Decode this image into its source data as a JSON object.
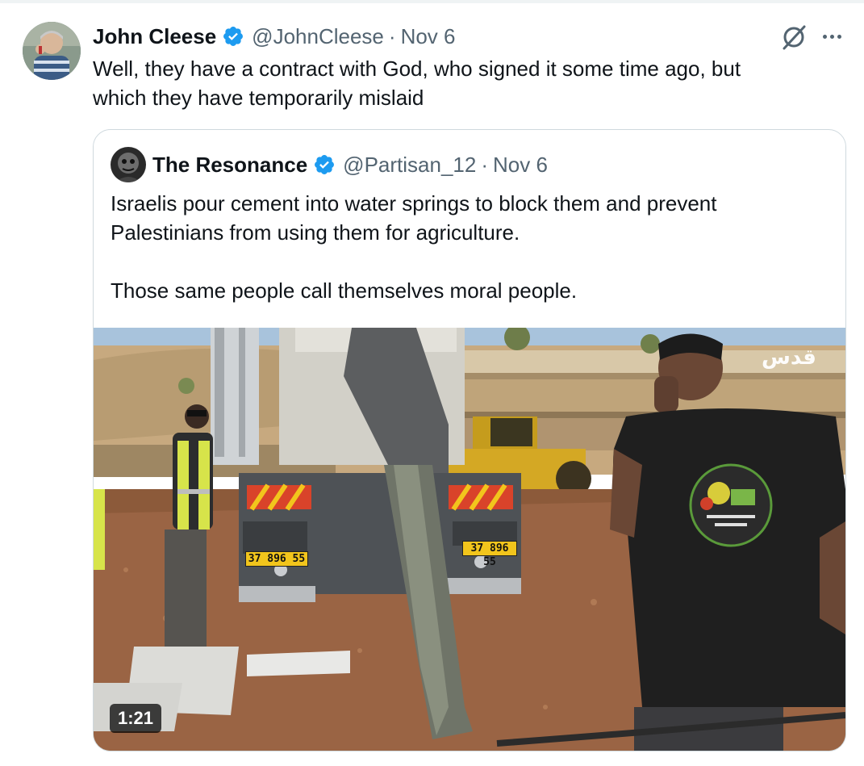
{
  "tweet": {
    "author": {
      "name": "John Cleese",
      "handle": "@JohnCleese",
      "date": "Nov 6",
      "verified": true
    },
    "separator": "·",
    "text_lines": [
      "Well, they have a contract with God, who signed it some time ago, but",
      "which they have temporarily mislaid"
    ],
    "icons": [
      "grok-icon",
      "more-icon"
    ]
  },
  "quote": {
    "author": {
      "name": "The Resonance",
      "handle": "@Partisan_12",
      "date": "Nov 6",
      "verified": true
    },
    "separator": "·",
    "paragraphs": [
      "Israelis pour cement into water springs to block them and prevent",
      "Palestinians from using them for agriculture.",
      "Those same people call themselves moral people."
    ],
    "video": {
      "duration": "1:21",
      "watermark": "قدس",
      "plates": [
        "37 896 55",
        "37 896 55"
      ]
    }
  },
  "colors": {
    "text": "#0f1419",
    "secondary": "#536471",
    "verified_blue": "#1d9bf0",
    "border": "#cfd9de"
  }
}
